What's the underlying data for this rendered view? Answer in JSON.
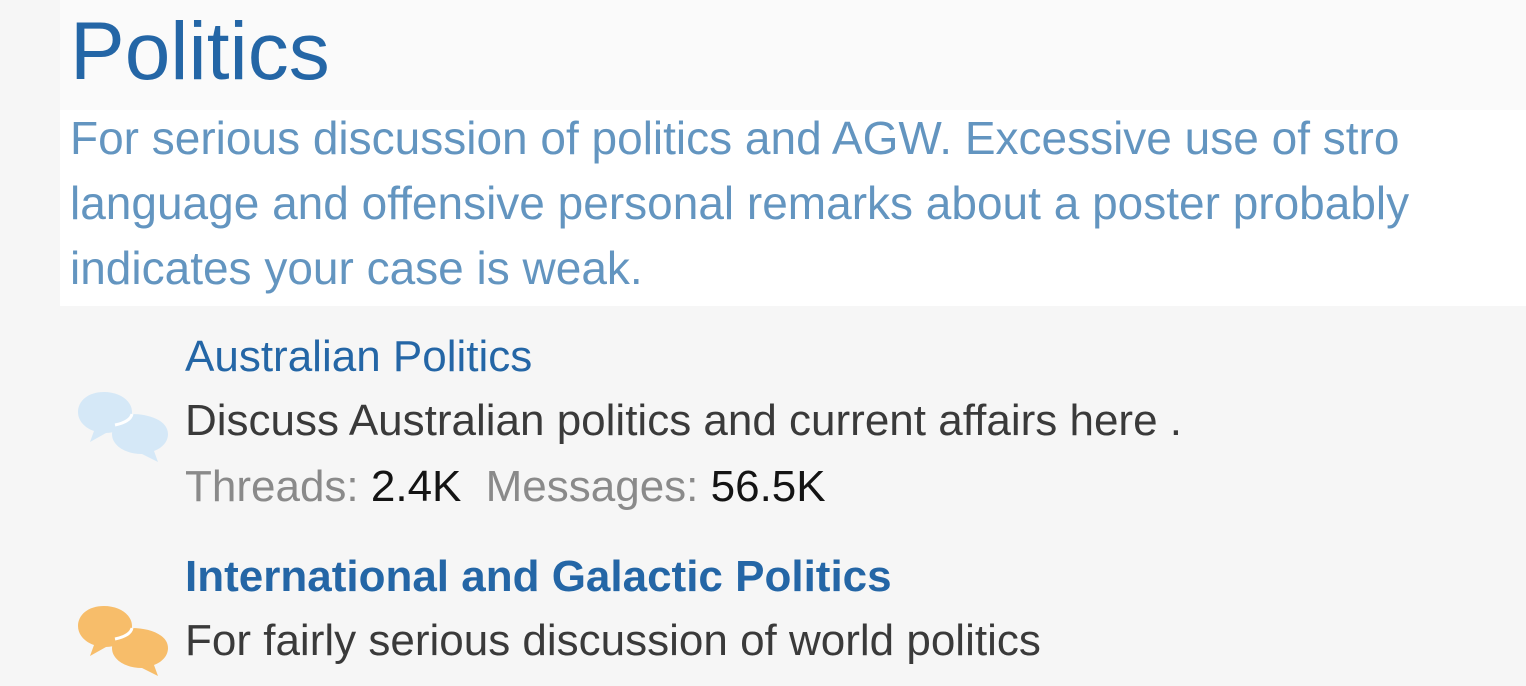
{
  "category": {
    "title": "Politics",
    "description_lines": [
      "For serious discussion of politics and AGW. Excessive use of stro",
      "language and offensive personal remarks about a poster probably",
      "indicates your case is weak."
    ]
  },
  "forums": [
    {
      "title": "Australian Politics",
      "description": "Discuss Australian politics and current affairs here .",
      "threads_label": "Threads:",
      "threads_value": "2.4K",
      "messages_label": "Messages:",
      "messages_value": "56.5K",
      "icon": "speech-bubbles-icon",
      "icon_color": "#d5e8f7",
      "unread": false
    },
    {
      "title": "International and Galactic Politics",
      "description": "For fairly serious discussion of world politics",
      "icon": "speech-bubbles-icon",
      "icon_color": "#f7bd6a",
      "unread": true
    }
  ],
  "colors": {
    "link": "#2466a6",
    "description": "#6395c0",
    "read_icon": "#d5e8f7",
    "unread_icon": "#f7bd6a"
  }
}
